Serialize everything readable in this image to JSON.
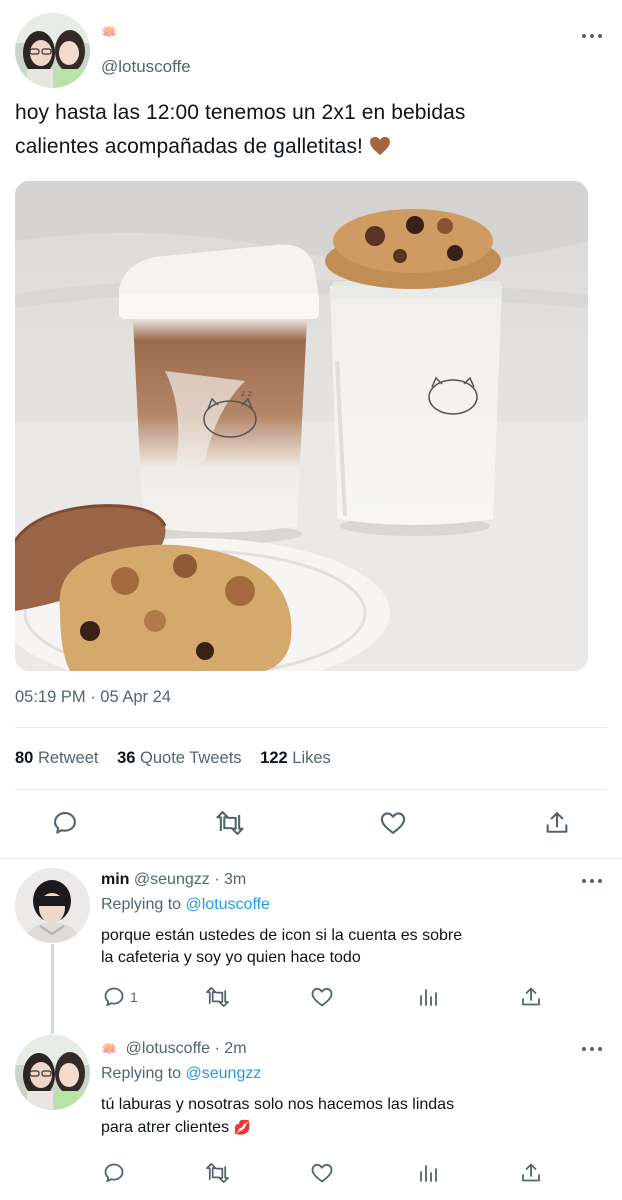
{
  "main_tweet": {
    "handle": "@lotuscoffe",
    "name_emoji": "🪷",
    "text_line1": "hoy hasta las 12:00 tenemos un 2x1 en bebidas",
    "text_line2": "calientes acompañadas de galletitas!",
    "timestamp": "05:19 PM · 05 Apr 24",
    "stats": {
      "retweets": "80",
      "retweets_label": "Retweet",
      "quotes": "36",
      "quotes_label": "Quote Tweets",
      "likes": "122",
      "likes_label": "Likes"
    },
    "actions": [
      "reply-icon",
      "retweet-icon",
      "like-icon",
      "share-icon"
    ]
  },
  "replies": [
    {
      "name": "min",
      "handle": "@seungzz",
      "time": "· 3m",
      "replying_prefix": "Replying to",
      "replying_to": "@lotuscoffe",
      "line1": "porque están ustedes de icon si la cuenta es sobre",
      "line2": "la cafeteria y soy yo quien hace todo",
      "reply_count": "1"
    },
    {
      "name_emoji": "🪷",
      "handle": "@lotuscoffe",
      "time": "· 2m",
      "replying_prefix": "Replying to",
      "replying_to": "@seungzz",
      "line1": "tú laburas y nosotras solo nos hacemos las lindas",
      "line2": "para atrer clientes",
      "line2_emoji": "💋"
    }
  ],
  "colors": {
    "text": "#0f1419",
    "secondary": "#536471",
    "link": "#1d9bf0",
    "divider": "#e4e8eb"
  }
}
